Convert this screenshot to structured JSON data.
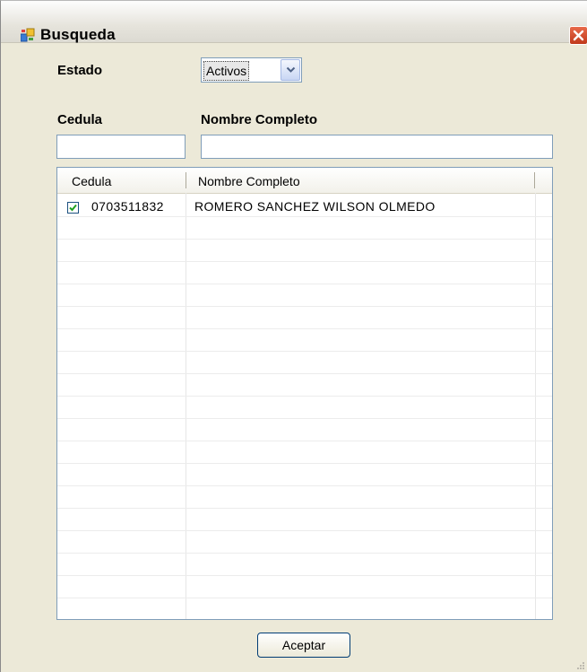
{
  "window": {
    "title": "Busqueda",
    "icon": "form-window-icon",
    "close_icon": "close-icon"
  },
  "filters": {
    "estado_label": "Estado",
    "estado_value": "Activos",
    "cedula_label": "Cedula",
    "nombre_label": "Nombre Completo",
    "cedula_value": "",
    "nombre_value": ""
  },
  "grid": {
    "columns": [
      "Cedula",
      "Nombre Completo"
    ],
    "rows": [
      {
        "checked": true,
        "cedula": "0703511832",
        "nombre": "ROMERO SANCHEZ WILSON OLMEDO"
      }
    ]
  },
  "buttons": {
    "accept_label": "Aceptar"
  },
  "colors": {
    "window_bg": "#ece9d8",
    "border": "#7f9db9",
    "close_red": "#c0391b"
  }
}
